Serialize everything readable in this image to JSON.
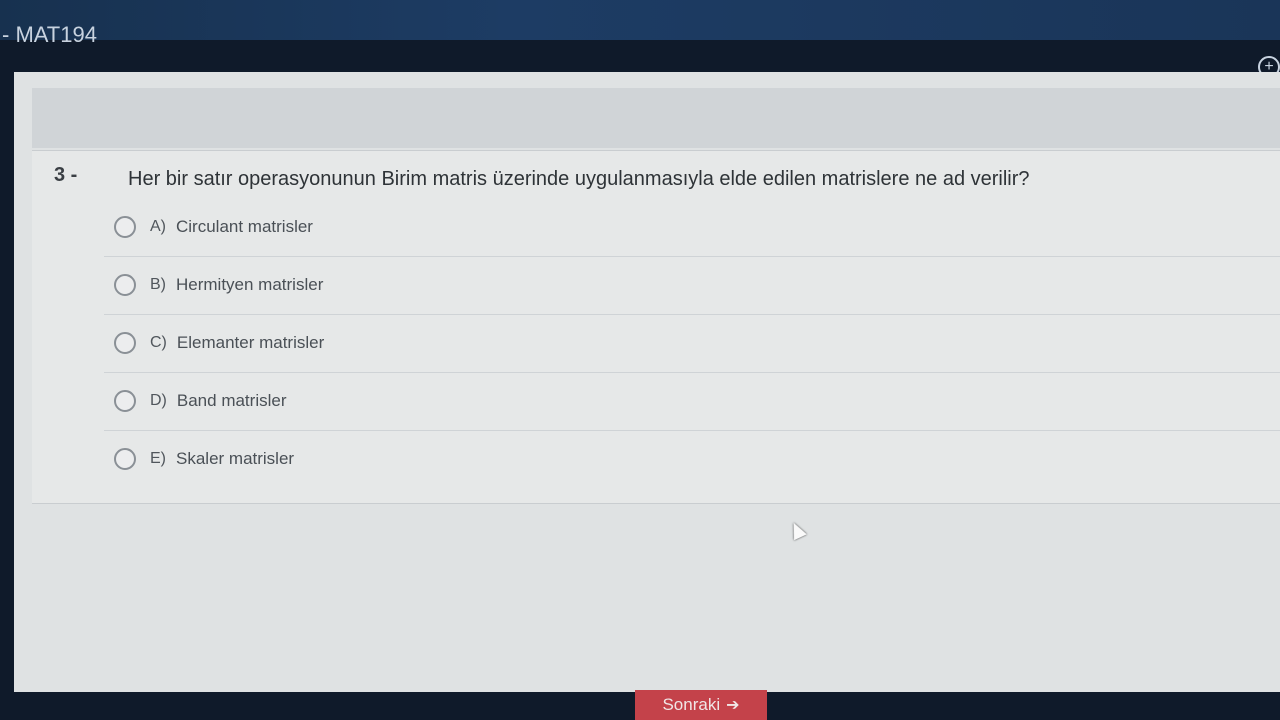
{
  "header": {
    "course_code": "- MAT194"
  },
  "question": {
    "number": "3 -",
    "text": "Her bir satır operasyonunun Birim matris üzerinde uygulanmasıyla elde edilen matrislere ne ad verilir?",
    "options": [
      {
        "letter": "A)",
        "text": "Circulant matrisler"
      },
      {
        "letter": "B)",
        "text": "Hermityen matrisler"
      },
      {
        "letter": "C)",
        "text": "Elemanter matrisler"
      },
      {
        "letter": "D)",
        "text": "Band matrisler"
      },
      {
        "letter": "E)",
        "text": "Skaler matrisler"
      }
    ]
  },
  "footer": {
    "next_label": "Sonraki",
    "next_icon": "arrow-right-icon"
  },
  "colors": {
    "accent": "#c4424a",
    "panel": "#e6e8e8"
  }
}
